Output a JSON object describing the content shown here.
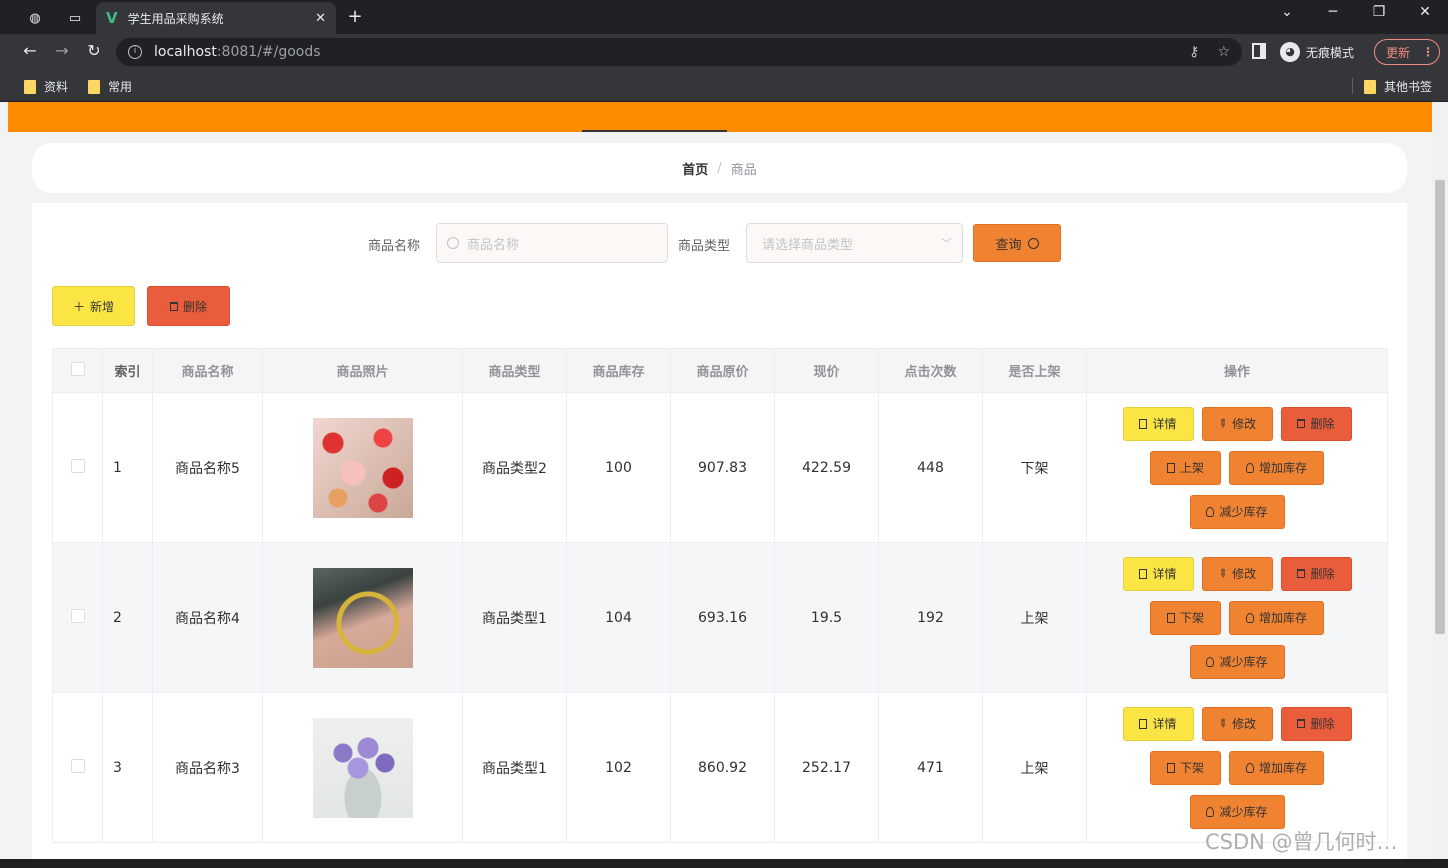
{
  "browser": {
    "tab_title": "学生用品采购系统",
    "url_host": "localhost",
    "url_rest": ":8081/#/goods",
    "incognito_label": "无痕模式",
    "update_label": "更新",
    "bookmarks": [
      "资料",
      "常用"
    ],
    "other_bookmarks": "其他书签"
  },
  "breadcrumb": {
    "home": "首页",
    "separator": "/",
    "current": "商品"
  },
  "search": {
    "name_label": "商品名称",
    "name_placeholder": "商品名称",
    "type_label": "商品类型",
    "type_placeholder": "请选择商品类型",
    "query_button": "查询"
  },
  "actions": {
    "add": "新增",
    "delete": "删除"
  },
  "table": {
    "headers": [
      "索引",
      "商品名称",
      "商品照片",
      "商品类型",
      "商品库存",
      "商品原价",
      "现价",
      "点击次数",
      "是否上架",
      "操作"
    ],
    "rows": [
      {
        "index": "1",
        "name": "商品名称5",
        "type": "商品类型2",
        "stock": "100",
        "orig_price": "907.83",
        "price": "422.59",
        "clicks": "448",
        "status": "下架",
        "shelf_action": "上架",
        "image": "flowers-roses"
      },
      {
        "index": "2",
        "name": "商品名称4",
        "type": "商品类型1",
        "stock": "104",
        "orig_price": "693.16",
        "price": "19.5",
        "clicks": "192",
        "status": "上架",
        "shelf_action": "下架",
        "image": "gold-bangle-hand"
      },
      {
        "index": "3",
        "name": "商品名称3",
        "type": "商品类型1",
        "stock": "102",
        "orig_price": "860.92",
        "price": "252.17",
        "clicks": "471",
        "status": "上架",
        "shelf_action": "下架",
        "image": "purple-bouquet"
      }
    ],
    "op_labels": {
      "detail": "详情",
      "edit": "修改",
      "delete": "删除",
      "add_stock": "增加库存",
      "reduce_stock": "减少库存"
    }
  },
  "watermark": "CSDN @曾几何时…",
  "colors": {
    "nav": "#ff8c00",
    "primary_btn": "#f08332",
    "yellow_btn": "#fbe544",
    "danger_btn": "#ea5d3c"
  }
}
